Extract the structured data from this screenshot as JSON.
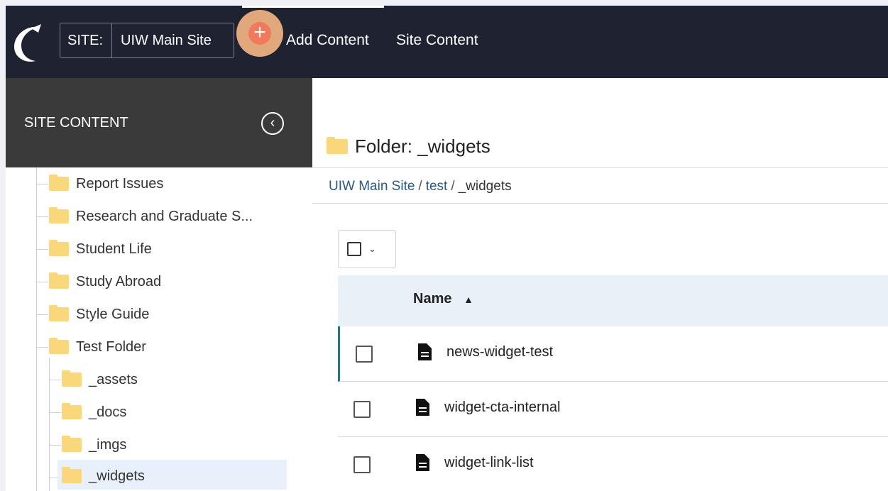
{
  "topbar": {
    "site_label": "SITE:",
    "site_value": "UIW Main Site",
    "add_content": "Add Content",
    "site_content": "Site Content"
  },
  "sidebar": {
    "title": "SITE CONTENT",
    "items": [
      {
        "label": "Report Issues"
      },
      {
        "label": "Research and Graduate S..."
      },
      {
        "label": "Student Life"
      },
      {
        "label": "Study Abroad"
      },
      {
        "label": "Style Guide"
      },
      {
        "label": "Test Folder"
      },
      {
        "label": "_assets"
      },
      {
        "label": "_docs"
      },
      {
        "label": "_imgs"
      },
      {
        "label": "_widgets"
      }
    ]
  },
  "main": {
    "title": "Folder: _widgets",
    "breadcrumb": [
      "UIW Main Site",
      "test",
      "_widgets"
    ],
    "breadcrumb_sep": "/",
    "column_name": "Name",
    "sort_indicator": "▲",
    "rows": [
      {
        "name": "news-widget-test"
      },
      {
        "name": "widget-cta-internal"
      },
      {
        "name": "widget-link-list"
      }
    ]
  },
  "colors": {
    "topbar": "#1e2231",
    "sidebar_header": "#3a3a3a",
    "add_button": "#f17a5e",
    "folder": "#fad77b",
    "table_header": "#e9f0f8",
    "link": "#2a5a8a"
  }
}
